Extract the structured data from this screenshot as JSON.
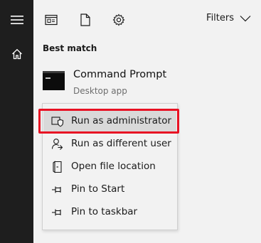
{
  "rail": {
    "items": [
      {
        "icon": "hamburger-menu-icon"
      },
      {
        "icon": "home-icon"
      }
    ]
  },
  "toolbar": {
    "icons": [
      "apps-icon",
      "documents-icon",
      "settings-icon"
    ],
    "filters_label": "Filters"
  },
  "section_heading": "Best match",
  "result": {
    "title": "Command Prompt",
    "subtitle": "Desktop app"
  },
  "context_menu": {
    "items": [
      {
        "label": "Run as administrator",
        "icon": "shield-icon",
        "highlighted": true
      },
      {
        "label": "Run as different user",
        "icon": "user-icon"
      },
      {
        "label": "Open file location",
        "icon": "file-location-icon"
      },
      {
        "label": "Pin to Start",
        "icon": "pin-icon"
      },
      {
        "label": "Pin to taskbar",
        "icon": "pin-icon"
      }
    ]
  },
  "colors": {
    "rail": "#1e1e1e",
    "background": "#f2f2f2",
    "highlight": "#d9d9d9",
    "callout": "#e81123"
  }
}
